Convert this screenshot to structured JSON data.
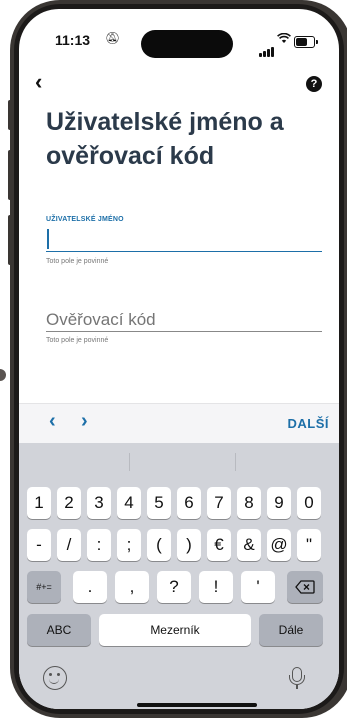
{
  "status_bar": {
    "time": "11:13"
  },
  "nav": {
    "back_glyph": "‹",
    "help_glyph": "?"
  },
  "page": {
    "title": "Uživatelské jméno a ověřovací kód"
  },
  "username_field": {
    "label": "UŽIVATELSKÉ JMÉNO",
    "value": "",
    "helper": "Toto pole je povinné"
  },
  "code_field": {
    "placeholder": "Ověřovací kód",
    "helper": "Toto pole je povinné"
  },
  "accessory_bar": {
    "prev_glyph": "‹",
    "next_glyph": "›",
    "next_label": "DALŠÍ"
  },
  "keyboard": {
    "row1": [
      "1",
      "2",
      "3",
      "4",
      "5",
      "6",
      "7",
      "8",
      "9",
      "0"
    ],
    "row2": [
      "-",
      "/",
      ":",
      ";",
      "(",
      ")",
      "€",
      "&",
      "@",
      "\""
    ],
    "row3_fn": "#+=",
    "row3": [
      ".",
      ",",
      "?",
      "!",
      "'"
    ],
    "abc": "ABC",
    "space": "Mezerník",
    "return": "Dále"
  },
  "icons": [
    "bell-slash-icon",
    "cellular-signal-icon",
    "wifi-icon",
    "battery-icon",
    "back-chevron-icon",
    "help-icon",
    "backspace-icon",
    "emoji-icon",
    "microphone-icon"
  ],
  "colors": {
    "accent": "#1d6fa8",
    "title": "#2b3a4a",
    "keyboard_bg": "#d1d3d9"
  }
}
